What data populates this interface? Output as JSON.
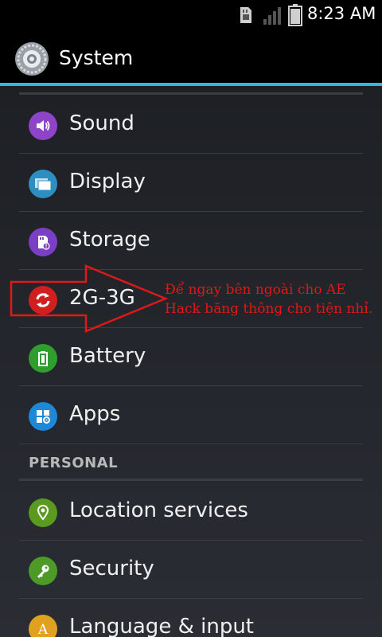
{
  "status_bar": {
    "time": "8:23 AM",
    "icons": [
      "sd-card-notification-icon",
      "signal-icon",
      "battery-icon"
    ]
  },
  "action_bar": {
    "title": "System",
    "icon": "settings-gear-icon",
    "accent_color": "#33b5e5"
  },
  "items": [
    {
      "label": "Sound",
      "icon": "volume-icon",
      "color": "#8e44c9"
    },
    {
      "label": "Display",
      "icon": "display-icon",
      "color": "#2e8ec0"
    },
    {
      "label": "Storage",
      "icon": "storage-icon",
      "color": "#7b3fc4"
    },
    {
      "label": "2G-3G",
      "icon": "refresh-icon",
      "color": "#d01f1f"
    },
    {
      "label": "Battery",
      "icon": "battery-icon",
      "color": "#2f9e2f"
    },
    {
      "label": "Apps",
      "icon": "apps-icon",
      "color": "#1e88d8"
    }
  ],
  "personal_header": "PERSONAL",
  "personal_items": [
    {
      "label": "Location services",
      "icon": "location-icon",
      "color": "#5a9a1e"
    },
    {
      "label": "Security",
      "icon": "key-icon",
      "color": "#4e9a26"
    },
    {
      "label": "Language & input",
      "icon": "language-icon",
      "color": "#e0a020"
    }
  ],
  "annotation": {
    "line1": "Để ngay bên ngoài cho AE",
    "line2": "Hack băng thông cho tiện nhỉ.",
    "color": "#e01818"
  }
}
